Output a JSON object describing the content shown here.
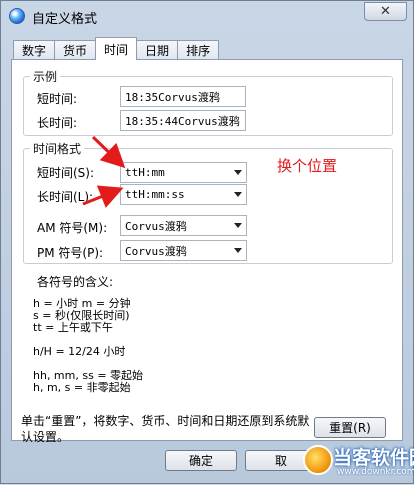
{
  "window": {
    "title": "自定义格式",
    "close_glyph": "✕"
  },
  "tabs": [
    {
      "label": "数字",
      "active": false
    },
    {
      "label": "货币",
      "active": false
    },
    {
      "label": "时间",
      "active": true
    },
    {
      "label": "日期",
      "active": false
    },
    {
      "label": "排序",
      "active": false
    }
  ],
  "sample": {
    "legend": "示例",
    "short_label": "短时间:",
    "short_value": "18:35Corvus渡鸦",
    "long_label": "长时间:",
    "long_value": "18:35:44Corvus渡鸦"
  },
  "formats": {
    "legend": "时间格式",
    "short_label": "短时间(S):",
    "short_value": "ttH:mm",
    "long_label": "长时间(L):",
    "long_value": "ttH:mm:ss",
    "am_label": "AM 符号(M):",
    "am_value": "Corvus渡鸦",
    "pm_label": "PM 符号(P):",
    "pm_value": "Corvus渡鸦"
  },
  "annotation": {
    "text": "换个位置",
    "color": "#e31b1b"
  },
  "symbols": {
    "heading": "各符号的含义:",
    "line1": "h = 小时   m = 分钟",
    "line2": "s = 秒(仅限长时间)",
    "line3": "tt = 上午或下午",
    "line4": "h/H = 12/24 小时",
    "line5": "hh, mm, ss = 零起始",
    "line6": "h, m, s = 非零起始"
  },
  "reset": {
    "note": "单击“重置”，将数字、货币、时间和日期还原到系统默认设置。",
    "button": "重置(R)"
  },
  "footer": {
    "ok": "确定",
    "cancel": "取"
  },
  "watermark": {
    "brand": "当客软件园",
    "url": "www.downkr.com"
  }
}
